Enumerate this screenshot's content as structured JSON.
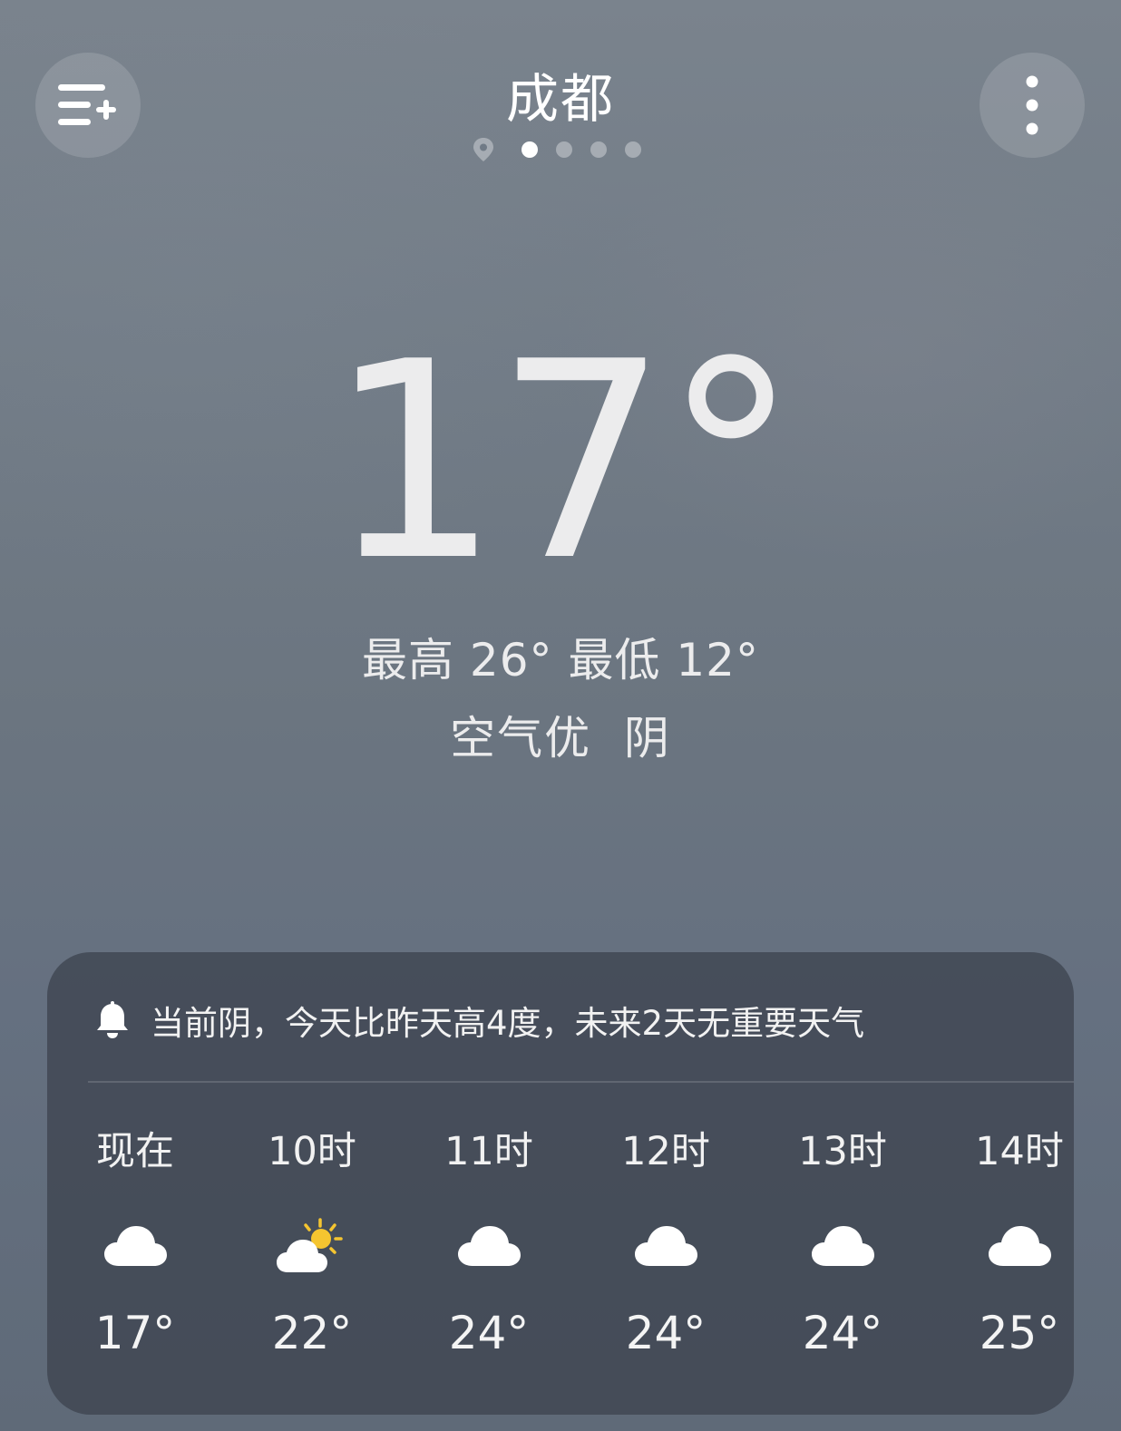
{
  "header": {
    "city": "成都",
    "menu_icon": "add-city-list-icon",
    "more_icon": "more-vertical-icon",
    "location_icon": "location-pin-icon",
    "page_indicator": {
      "total_pages": 4,
      "active_index": 0
    }
  },
  "current": {
    "temperature": "17°",
    "range": "最高 26° 最低 12°",
    "condition": "空气优  阴"
  },
  "card": {
    "alert_icon": "bell-icon",
    "alert_text": "当前阴，今天比昨天高4度，未来2天无重要天气",
    "hourly": [
      {
        "label": "现在",
        "icon": "cloud-icon",
        "temp": "17°"
      },
      {
        "label": "10时",
        "icon": "partly-sunny-icon",
        "temp": "22°"
      },
      {
        "label": "11时",
        "icon": "cloud-icon",
        "temp": "24°"
      },
      {
        "label": "12时",
        "icon": "cloud-icon",
        "temp": "24°"
      },
      {
        "label": "13时",
        "icon": "cloud-icon",
        "temp": "24°"
      },
      {
        "label": "14时",
        "icon": "cloud-icon",
        "temp": "25°"
      }
    ]
  },
  "colors": {
    "sun": "#f5c530",
    "card_bg": "#3e4450",
    "text": "#ececed"
  }
}
